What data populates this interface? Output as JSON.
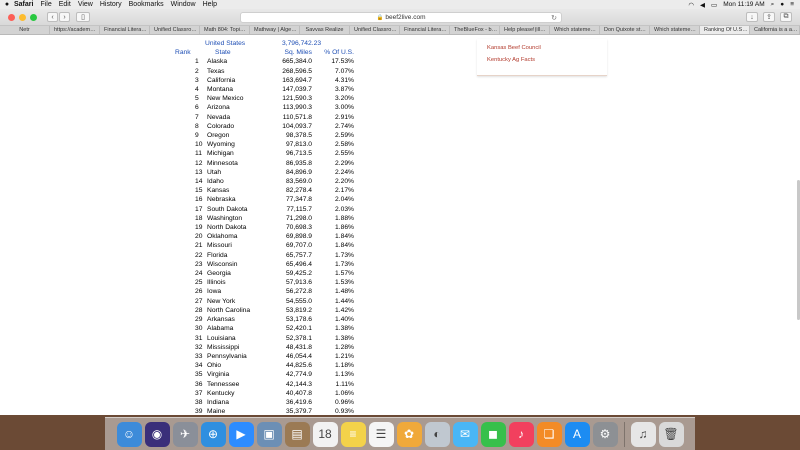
{
  "menubar": {
    "app_name": "Safari",
    "items": [
      "File",
      "Edit",
      "View",
      "History",
      "Bookmarks",
      "Window",
      "Help"
    ],
    "clock": "Mon 11:19 AM"
  },
  "toolbar": {
    "address": "beef2live.com"
  },
  "tabs": [
    "Netr",
    "https://academ…",
    "Financial Litera…",
    "Unified Classro…",
    "Math 804: Topi…",
    "Mathway | Alge…",
    "Savvas Realize",
    "Unified Classro…",
    "Financial Litera…",
    "TheBlueFox - b…",
    "Help please!(ill…",
    "Which stateme…",
    "Don Quixote st…",
    "Which stateme…",
    "Ranking Of U.S…",
    "California is a a…"
  ],
  "table": {
    "us_title": "United States",
    "us_total": "3,796,742.23",
    "headers": {
      "rank": "Rank",
      "state": "State",
      "miles": "Sq. Miles",
      "pct": "% Of U.S."
    },
    "rows": [
      {
        "rank": "1",
        "state": "Alaska",
        "miles": "665,384.0",
        "pct": "17.53%"
      },
      {
        "rank": "2",
        "state": "Texas",
        "miles": "268,596.5",
        "pct": "7.07%"
      },
      {
        "rank": "3",
        "state": "California",
        "miles": "163,694.7",
        "pct": "4.31%"
      },
      {
        "rank": "4",
        "state": "Montana",
        "miles": "147,039.7",
        "pct": "3.87%"
      },
      {
        "rank": "5",
        "state": "New Mexico",
        "miles": "121,590.3",
        "pct": "3.20%"
      },
      {
        "rank": "6",
        "state": "Arizona",
        "miles": "113,990.3",
        "pct": "3.00%"
      },
      {
        "rank": "7",
        "state": "Nevada",
        "miles": "110,571.8",
        "pct": "2.91%"
      },
      {
        "rank": "8",
        "state": "Colorado",
        "miles": "104,093.7",
        "pct": "2.74%"
      },
      {
        "rank": "9",
        "state": "Oregon",
        "miles": "98,378.5",
        "pct": "2.59%"
      },
      {
        "rank": "10",
        "state": "Wyoming",
        "miles": "97,813.0",
        "pct": "2.58%"
      },
      {
        "rank": "11",
        "state": "Michigan",
        "miles": "96,713.5",
        "pct": "2.55%"
      },
      {
        "rank": "12",
        "state": "Minnesota",
        "miles": "86,935.8",
        "pct": "2.29%"
      },
      {
        "rank": "13",
        "state": "Utah",
        "miles": "84,896.9",
        "pct": "2.24%"
      },
      {
        "rank": "14",
        "state": "Idaho",
        "miles": "83,569.0",
        "pct": "2.20%"
      },
      {
        "rank": "15",
        "state": "Kansas",
        "miles": "82,278.4",
        "pct": "2.17%"
      },
      {
        "rank": "16",
        "state": "Nebraska",
        "miles": "77,347.8",
        "pct": "2.04%"
      },
      {
        "rank": "17",
        "state": "South Dakota",
        "miles": "77,115.7",
        "pct": "2.03%"
      },
      {
        "rank": "18",
        "state": "Washington",
        "miles": "71,298.0",
        "pct": "1.88%"
      },
      {
        "rank": "19",
        "state": "North Dakota",
        "miles": "70,698.3",
        "pct": "1.86%"
      },
      {
        "rank": "20",
        "state": "Oklahoma",
        "miles": "69,898.9",
        "pct": "1.84%"
      },
      {
        "rank": "21",
        "state": "Missouri",
        "miles": "69,707.0",
        "pct": "1.84%"
      },
      {
        "rank": "22",
        "state": "Florida",
        "miles": "65,757.7",
        "pct": "1.73%"
      },
      {
        "rank": "23",
        "state": "Wisconsin",
        "miles": "65,496.4",
        "pct": "1.73%"
      },
      {
        "rank": "24",
        "state": "Georgia",
        "miles": "59,425.2",
        "pct": "1.57%"
      },
      {
        "rank": "25",
        "state": "Illinois",
        "miles": "57,913.6",
        "pct": "1.53%"
      },
      {
        "rank": "26",
        "state": "Iowa",
        "miles": "56,272.8",
        "pct": "1.48%"
      },
      {
        "rank": "27",
        "state": "New York",
        "miles": "54,555.0",
        "pct": "1.44%"
      },
      {
        "rank": "28",
        "state": "North Carolina",
        "miles": "53,819.2",
        "pct": "1.42%"
      },
      {
        "rank": "29",
        "state": "Arkansas",
        "miles": "53,178.6",
        "pct": "1.40%"
      },
      {
        "rank": "30",
        "state": "Alabama",
        "miles": "52,420.1",
        "pct": "1.38%"
      },
      {
        "rank": "31",
        "state": "Louisiana",
        "miles": "52,378.1",
        "pct": "1.38%"
      },
      {
        "rank": "32",
        "state": "Mississippi",
        "miles": "48,431.8",
        "pct": "1.28%"
      },
      {
        "rank": "33",
        "state": "Pennsylvania",
        "miles": "46,054.4",
        "pct": "1.21%"
      },
      {
        "rank": "34",
        "state": "Ohio",
        "miles": "44,825.6",
        "pct": "1.18%"
      },
      {
        "rank": "35",
        "state": "Virginia",
        "miles": "42,774.9",
        "pct": "1.13%"
      },
      {
        "rank": "36",
        "state": "Tennessee",
        "miles": "42,144.3",
        "pct": "1.11%"
      },
      {
        "rank": "37",
        "state": "Kentucky",
        "miles": "40,407.8",
        "pct": "1.06%"
      },
      {
        "rank": "38",
        "state": "Indiana",
        "miles": "36,419.6",
        "pct": "0.96%"
      },
      {
        "rank": "39",
        "state": "Maine",
        "miles": "35,379.7",
        "pct": "0.93%"
      }
    ]
  },
  "sidebar": {
    "links": [
      "Kansas Beef Council",
      "Kentucky Ag Facts"
    ]
  },
  "colors": {
    "header_blue": "#1f4fb5",
    "link_red": "#b23a2c",
    "desktop_brown": "#6b4a35"
  },
  "dock": [
    {
      "icon": "finder-icon",
      "color": "#3d8bd9",
      "glyph": "☺"
    },
    {
      "icon": "siri-icon",
      "color": "#3a2f7a",
      "glyph": "◉"
    },
    {
      "icon": "launchpad-icon",
      "color": "#8a8f99",
      "glyph": "✈"
    },
    {
      "icon": "safari-icon",
      "color": "#2f8fe0",
      "glyph": "⊕"
    },
    {
      "icon": "zoom-icon",
      "color": "#2d8cff",
      "glyph": "▶"
    },
    {
      "icon": "preview-icon",
      "color": "#6c8fb5",
      "glyph": "▣"
    },
    {
      "icon": "contacts-icon",
      "color": "#9b7a54",
      "glyph": "▤"
    },
    {
      "icon": "calendar-icon",
      "color": "#f2f2f2",
      "glyph": "18"
    },
    {
      "icon": "notes-icon",
      "color": "#f3d24a",
      "glyph": "≡"
    },
    {
      "icon": "reminders-icon",
      "color": "#f5f5f5",
      "glyph": "☰"
    },
    {
      "icon": "photos-icon",
      "color": "#f0a93a",
      "glyph": "✿"
    },
    {
      "icon": "photo-booth-icon",
      "color": "#c0c8d0",
      "glyph": "◐"
    },
    {
      "icon": "messages-icon",
      "color": "#49b6f5",
      "glyph": "✉"
    },
    {
      "icon": "facetime-icon",
      "color": "#37c04b",
      "glyph": "◼"
    },
    {
      "icon": "music-icon",
      "color": "#f2405e",
      "glyph": "♪"
    },
    {
      "icon": "books-icon",
      "color": "#f38b26",
      "glyph": "❏"
    },
    {
      "icon": "app-store-icon",
      "color": "#1c8cf2",
      "glyph": "A"
    },
    {
      "icon": "system-preferences-icon",
      "color": "#8d9094",
      "glyph": "⚙"
    },
    {
      "icon": "music-file-icon",
      "color": "#e6e6e6",
      "glyph": "♫"
    },
    {
      "icon": "trash-icon",
      "color": "#d9d9d9",
      "glyph": "🗑"
    }
  ]
}
